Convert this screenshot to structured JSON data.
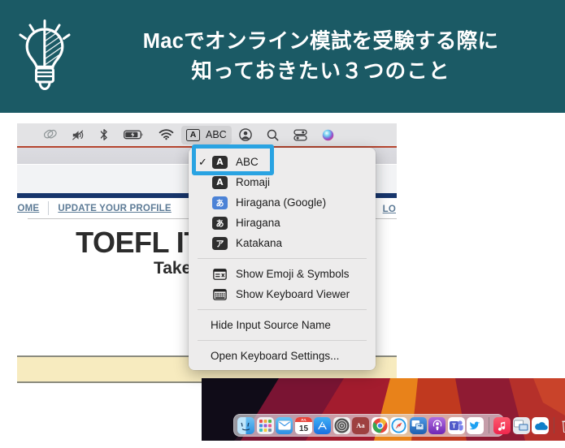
{
  "header": {
    "icon": "lightbulb-icon",
    "bg_color": "#1b5a65",
    "text_color": "#ffffff",
    "line1": "Macでオンライン模試を受験する際に",
    "line2": "知っておきたい３つのこと"
  },
  "menubar": {
    "items": [
      {
        "name": "creative-cloud-icon",
        "label": ""
      },
      {
        "name": "volume-muted-icon",
        "label": ""
      },
      {
        "name": "bluetooth-icon",
        "label": ""
      },
      {
        "name": "battery-charging-icon",
        "label": ""
      },
      {
        "name": "wifi-icon",
        "label": ""
      },
      {
        "name": "input-source-menu",
        "label": "ABC",
        "chip": "A",
        "active": true
      },
      {
        "name": "user-account-icon",
        "label": ""
      },
      {
        "name": "spotlight-search-icon",
        "label": ""
      },
      {
        "name": "control-center-icon",
        "label": ""
      },
      {
        "name": "siri-icon",
        "label": ""
      }
    ]
  },
  "browser": {
    "nav_links": {
      "home": "HOME",
      "update_profile": "UPDATE YOUR PROFILE",
      "logout": "LO"
    },
    "page_heading": "TOEFL ITP® Online",
    "page_subheading": "Take the Test"
  },
  "dropdown": {
    "highlight_color": "#29a3e2",
    "sources": [
      {
        "checked": true,
        "chip": "A",
        "chip_style": "dark",
        "label": "ABC"
      },
      {
        "checked": false,
        "chip": "A",
        "chip_style": "dark",
        "label": "Romaji"
      },
      {
        "checked": false,
        "chip": "あ",
        "chip_style": "blue",
        "label": "Hiragana (Google)"
      },
      {
        "checked": false,
        "chip": "あ",
        "chip_style": "dark",
        "label": "Hiragana"
      },
      {
        "checked": false,
        "chip": "ア",
        "chip_style": "dark",
        "label": "Katakana"
      }
    ],
    "tools": [
      {
        "icon": "emoji-symbols-icon",
        "label": "Show Emoji & Symbols"
      },
      {
        "icon": "keyboard-viewer-icon",
        "label": "Show Keyboard Viewer"
      }
    ],
    "hide_input_source_name": "Hide Input Source Name",
    "open_keyboard_settings": "Open Keyboard Settings..."
  },
  "dock": {
    "items": [
      {
        "name": "finder-icon",
        "color": "#3da7f0"
      },
      {
        "name": "launchpad-icon",
        "color": "#e9e9ee"
      },
      {
        "name": "mail-icon",
        "color": "#3fa9f5"
      },
      {
        "name": "calendar-icon",
        "color": "#ffffff",
        "day": "15"
      },
      {
        "name": "app-store-icon",
        "color": "#1f8ef1"
      },
      {
        "name": "safari-dark-icon",
        "color": "#4a4a4a"
      },
      {
        "name": "dictionary-icon",
        "color": "#a54242",
        "glyph": "Aa"
      },
      {
        "name": "chrome-icon",
        "color": "#f3f3f3"
      },
      {
        "name": "safari-icon",
        "color": "#e8f2fb"
      },
      {
        "name": "remote-desktop-icon",
        "color": "#2d6cb5"
      },
      {
        "name": "podcasts-icon",
        "color": "#8a3fbe"
      },
      {
        "name": "teams-icon",
        "color": "#4b53bc"
      },
      {
        "name": "twitter-icon",
        "color": "#1da1f2"
      },
      {
        "name": "divider",
        "color": ""
      },
      {
        "name": "music-icon",
        "color": "#fb3b5c"
      },
      {
        "name": "screen-sharing-icon",
        "color": "#cfd4da"
      },
      {
        "name": "onedrive-icon",
        "color": "#ffffff"
      },
      {
        "name": "divider",
        "color": ""
      },
      {
        "name": "trash-icon",
        "color": "#d8d8d8"
      }
    ]
  }
}
